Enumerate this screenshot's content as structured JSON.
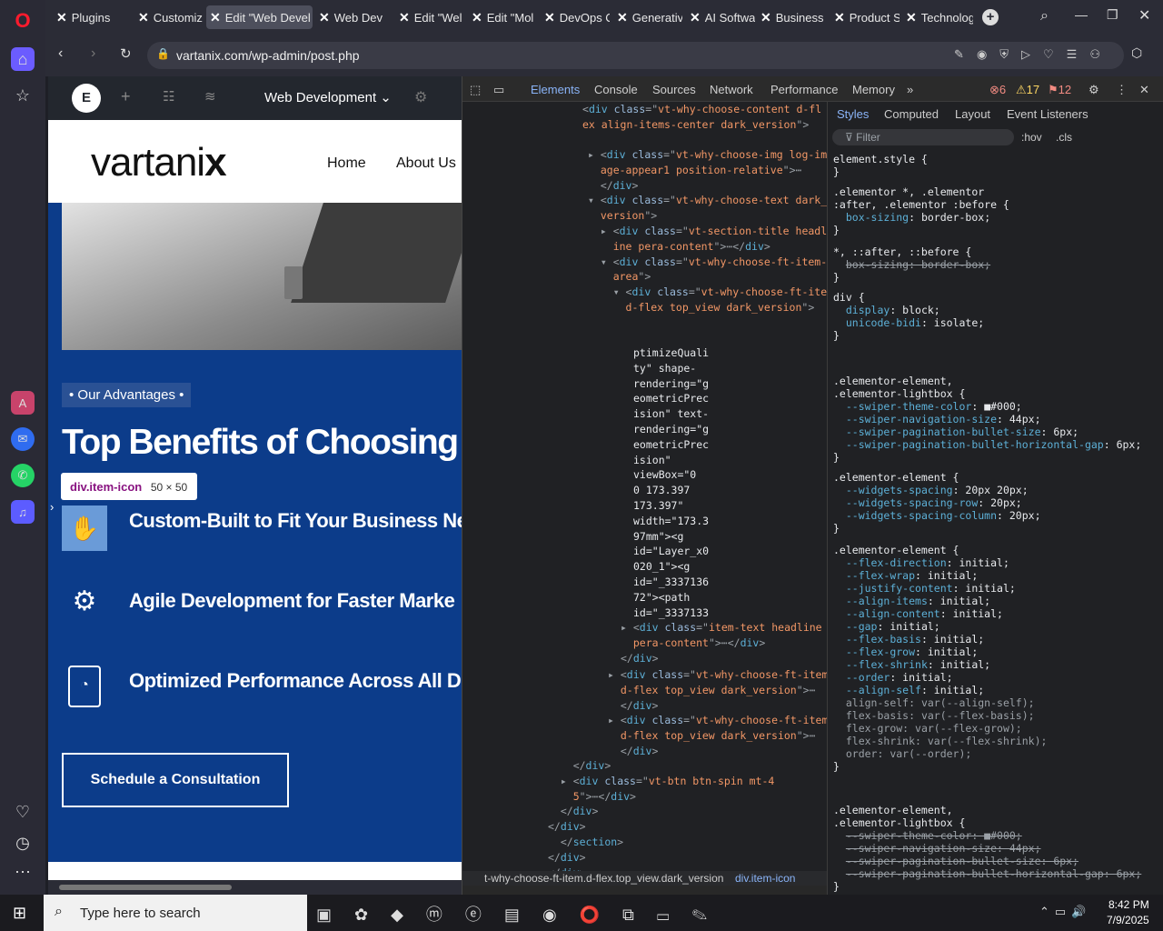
{
  "browser": {
    "tabs": [
      "Plugins",
      "Customiz",
      "Edit \"Web Devel",
      "Web Dev",
      "Edit \"Wel",
      "Edit \"Mol",
      "DevOps C",
      "Generativ",
      "AI Softwa",
      "Business",
      "Product S",
      "Technolog"
    ],
    "url": "vartanix.com/wp-admin/post.php"
  },
  "elementor": {
    "title": "Web Development"
  },
  "site": {
    "logo": "vartani",
    "logo_x": "x",
    "nav": [
      "Home",
      "About Us"
    ],
    "badge": "• Our Advantages •",
    "headline": "Top Benefits of Choosing Ou",
    "features": [
      "Custom-Built to Fit Your Business Ne",
      "Agile Development for Faster Marke",
      "Optimized Performance Across All D"
    ],
    "cta": "Schedule a Consultation",
    "tooltip_name": "div.item-icon",
    "tooltip_size": "50 × 50"
  },
  "devtools": {
    "tabs": [
      "Elements",
      "Console",
      "Sources",
      "Network",
      "Performance",
      "Memory"
    ],
    "errors": "6",
    "warnings": "17",
    "issues": "12",
    "style_tabs": [
      "Styles",
      "Computed",
      "Layout",
      "Event Listeners"
    ],
    "filter": "Filter",
    "hov": ":hov",
    ".cls": ".cls",
    "breadcrumb": [
      "t-why-choose-ft-item.d-flex.top_view.dark_version",
      "div.item-icon"
    ]
  },
  "taskbar": {
    "search": "Type here to search",
    "time": "8:42 PM",
    "date": "7/9/2025"
  }
}
